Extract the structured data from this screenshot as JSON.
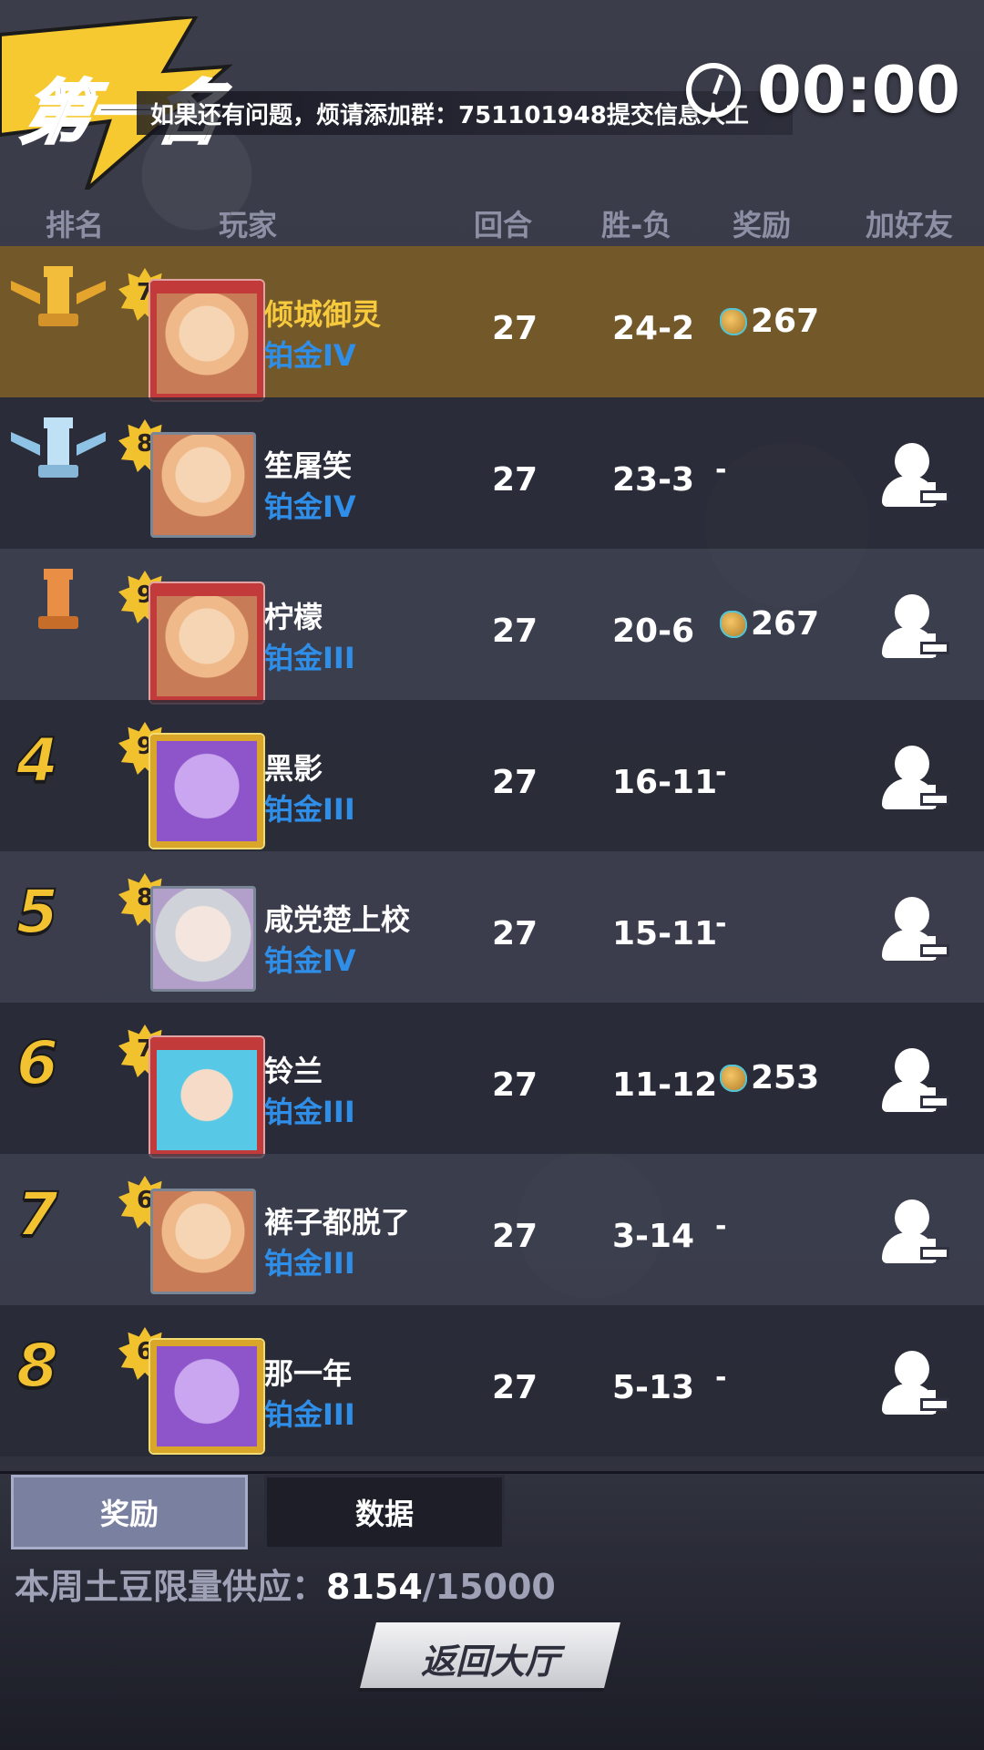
{
  "header": {
    "place_title": "第一名",
    "notice": "如果还有问题，烦请添加群：751101948提交信息人工",
    "timer": "00:00"
  },
  "columns": {
    "rank": "排名",
    "player": "玩家",
    "rounds": "回合",
    "win_loss": "胜-负",
    "reward": "奖励",
    "add_friend": "加好友"
  },
  "rows": [
    {
      "rank": "",
      "rank_icon": "gold-rook-icon",
      "level": "7",
      "name": "倾城御灵",
      "tier": "铂金IV",
      "rounds": "27",
      "win_loss": "24-2",
      "reward": "267",
      "has_add": false,
      "is_me": true
    },
    {
      "rank": "",
      "rank_icon": "silver-rook-icon",
      "level": "8",
      "name": "笙屠笑",
      "tier": "铂金IV",
      "rounds": "27",
      "win_loss": "23-3",
      "reward": "-",
      "has_add": true
    },
    {
      "rank": "",
      "rank_icon": "bronze-rook-icon",
      "level": "9",
      "name": "柠檬",
      "tier": "铂金III",
      "rounds": "27",
      "win_loss": "20-6",
      "reward": "267",
      "has_add": true
    },
    {
      "rank": "4",
      "level": "9",
      "name": "黑影",
      "tier": "铂金III",
      "rounds": "27",
      "win_loss": "16-11",
      "reward": "-",
      "has_add": true
    },
    {
      "rank": "5",
      "level": "8",
      "name": "咸党楚上校",
      "tier": "铂金IV",
      "rounds": "27",
      "win_loss": "15-11",
      "reward": "-",
      "has_add": true
    },
    {
      "rank": "6",
      "level": "7",
      "name": "铃兰",
      "tier": "铂金III",
      "rounds": "27",
      "win_loss": "11-12",
      "reward": "253",
      "has_add": true
    },
    {
      "rank": "7",
      "level": "6",
      "name": "裤子都脱了",
      "tier": "铂金III",
      "rounds": "27",
      "win_loss": "3-14",
      "reward": "-",
      "has_add": true
    },
    {
      "rank": "8",
      "level": "6",
      "name": "那一年",
      "tier": "铂金III",
      "rounds": "27",
      "win_loss": "5-13",
      "reward": "-",
      "has_add": true
    }
  ],
  "tabs": {
    "reward": "奖励",
    "data": "数据"
  },
  "supply": {
    "label": "本周土豆限量供应：",
    "current": "8154",
    "total": "/15000"
  },
  "back_button": "返回大厅",
  "colors": {
    "highlight_row": "#73592a",
    "tier_blue": "#2f8ee8",
    "rank_yellow": "#f3c231"
  }
}
